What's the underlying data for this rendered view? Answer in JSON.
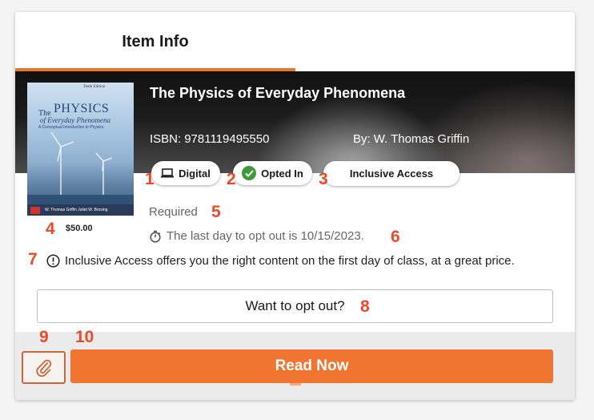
{
  "tabs": [
    {
      "label": "Item Info",
      "active": true
    }
  ],
  "item": {
    "title": "The Physics of Everyday Phenomena",
    "isbn_label": "ISBN:",
    "isbn_value": "9781119495550",
    "author_label": "By:",
    "author_value": "W. Thomas Griffin",
    "price": "$50.00",
    "cover": {
      "edition": "Tenth Edition",
      "the": "The",
      "physics": "PHYSICS",
      "sub": "of Everyday Phenomena",
      "small": "A Conceptual Introduction to Physics",
      "authors": "W. Thomas Griffin     Juliet W. Brosing"
    }
  },
  "badges": {
    "digital": "Digital",
    "opted_in": "Opted In",
    "inclusive_access": "Inclusive Access"
  },
  "status": {
    "required": "Required",
    "deadline": "The last day to opt out is 10/15/2023.",
    "info": "Inclusive Access offers you the right content on the first day of class, at a great price."
  },
  "buttons": {
    "opt_out": "Want to opt out?",
    "read_now": "Read Now"
  },
  "annotations": [
    "1",
    "2",
    "3",
    "4",
    "5",
    "6",
    "7",
    "8",
    "9",
    "10"
  ],
  "colors": {
    "accent": "#ef7530",
    "annotation": "#e84b2c",
    "opted_in_check": "#3d9a3a"
  },
  "icons": {
    "digital": "laptop-icon",
    "opted_in": "check-circle-icon",
    "deadline": "stopwatch-icon",
    "info": "info-circle-icon",
    "attach": "paperclip-icon"
  }
}
